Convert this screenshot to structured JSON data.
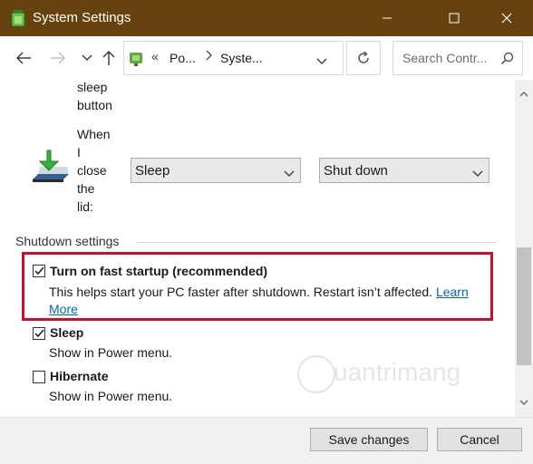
{
  "window": {
    "title": "System Settings",
    "minimize_icon": "minimize-icon",
    "maximize_icon": "maximize-icon",
    "close_icon": "close-icon"
  },
  "toolbar": {
    "breadcrumb_prefix": "«",
    "crumbs": [
      "Po...",
      "Syste..."
    ],
    "search_placeholder": "Search Contr..."
  },
  "lid_section": {
    "sleep_button_text_partial": [
      "sleep",
      "button"
    ],
    "lid_label_lines": [
      "When",
      "I",
      "close",
      "the",
      "lid:"
    ],
    "on_battery_value": "Sleep",
    "plugged_in_value": "Shut down"
  },
  "shutdown": {
    "title": "Shutdown settings",
    "options": [
      {
        "label": "Turn on fast startup (recommended)",
        "desc": "This helps start your PC faster after shutdown. Restart isn’t affected.",
        "link_a": "Learn",
        "link_b": "More",
        "checked": true
      },
      {
        "label": "Sleep",
        "desc": "Show in Power menu.",
        "checked": true
      },
      {
        "label": "Hibernate",
        "desc": "Show in Power menu.",
        "checked": false
      }
    ]
  },
  "footer": {
    "save_label": "Save changes",
    "cancel_label": "Cancel"
  },
  "watermark": {
    "text": "uantrimang"
  },
  "colors": {
    "titlebar": "#66420e",
    "highlight": "#c8102e",
    "link": "#0067b8"
  }
}
